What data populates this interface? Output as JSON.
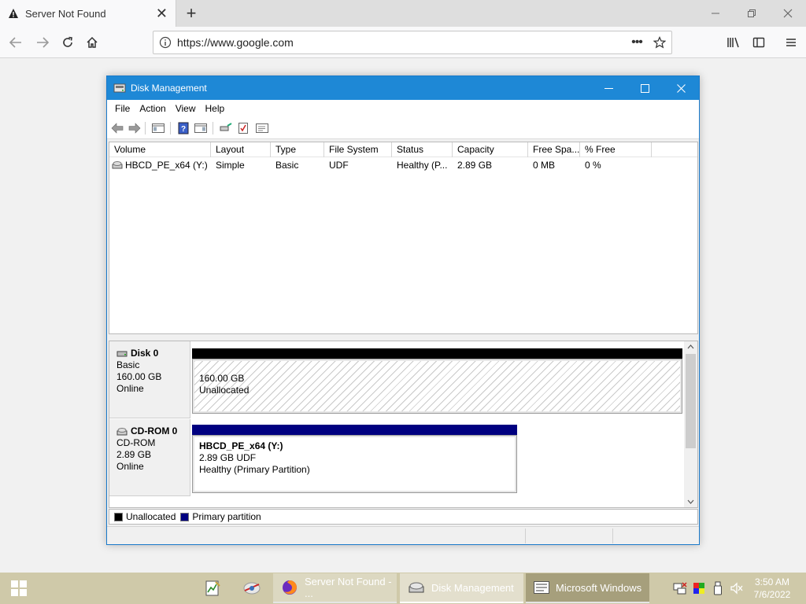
{
  "browser": {
    "tab_title": "Server Not Found",
    "url": "https://www.google.com",
    "page_action_dots": "•••"
  },
  "window": {
    "title": "Disk Management",
    "menu": [
      "File",
      "Action",
      "View",
      "Help"
    ]
  },
  "volumes": {
    "columns": [
      "Volume",
      "Layout",
      "Type",
      "File System",
      "Status",
      "Capacity",
      "Free Spa...",
      "% Free"
    ],
    "rows": [
      {
        "volume": "HBCD_PE_x64 (Y:)",
        "layout": "Simple",
        "type": "Basic",
        "file_system": "UDF",
        "status": "Healthy (P...",
        "capacity": "2.89 GB",
        "free_space": "0 MB",
        "percent_free": "0 %"
      }
    ]
  },
  "disks": [
    {
      "name": "Disk 0",
      "kind": "Basic",
      "size": "160.00 GB",
      "state": "Online",
      "partition": {
        "line1": "160.00 GB",
        "line2": "Unallocated"
      }
    },
    {
      "name": "CD-ROM 0",
      "kind": "CD-ROM",
      "size": "2.89 GB",
      "state": "Online",
      "partition": {
        "label": "HBCD_PE_x64  (Y:)",
        "line1": "2.89 GB UDF",
        "line2": "Healthy (Primary Partition)"
      }
    }
  ],
  "legend": [
    {
      "label": "Unallocated",
      "color": "#000000"
    },
    {
      "label": "Primary partition",
      "color": "#000080"
    }
  ],
  "taskbar": {
    "tasks": [
      "Server Not Found - ...",
      "Disk Management",
      "Microsoft Windows"
    ],
    "time": "3:50 AM",
    "date": "7/6/2022"
  }
}
